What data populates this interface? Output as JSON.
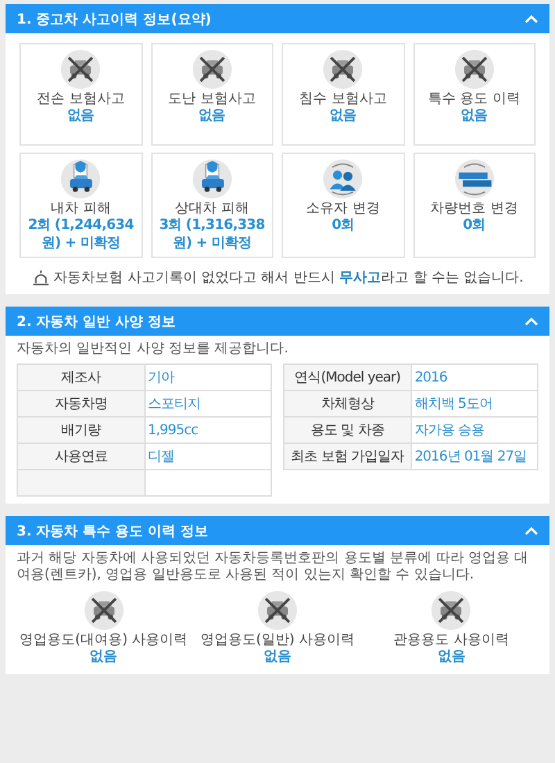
{
  "sections": [
    {
      "title": "1. 중고차 사고이력 정보(요약)",
      "expanded": true,
      "cards": [
        {
          "label": "전손 보험사고",
          "value": "없음"
        },
        {
          "label": "도난 보험사고",
          "value": "없음"
        },
        {
          "label": "침수 보험사고",
          "value": "없음"
        },
        {
          "label": "특수 용도 이력",
          "value": "없음"
        },
        {
          "label": "내차 피해",
          "value": "2회 (1,244,634 원) + 미확정"
        },
        {
          "label": "상대차 피해",
          "value": "3회 (1,316,338 원) + 미확정"
        },
        {
          "label": "소유자 변경",
          "value": "0회"
        },
        {
          "label": "차량번호 변경",
          "value": "0회"
        }
      ],
      "notice": "자동차보험 사고기록이 없었다고 해서 반드시 **무사고**라고 할 수는 없습니다."
    },
    {
      "title": "2. 자동차 일반 사양 정보",
      "expanded": true,
      "note": "자동차의 일반적인 사양 정보를 제공합니다.",
      "left_table": [
        {
          "label": "제조사",
          "value": "기아"
        },
        {
          "label": "자동차명",
          "value": "스포티지"
        },
        {
          "label": "배기량",
          "value": "1,995cc"
        },
        {
          "label": "사용연료",
          "value": "디젤"
        }
      ],
      "right_table": [
        {
          "label": "연식(Model year)",
          "value": "2016"
        },
        {
          "label": "차체형상",
          "value": "해치백 5도어"
        },
        {
          "label": "용도 및 차종",
          "value": "자가용 승용"
        },
        {
          "label": "최초 보험 가입일자",
          "value": "2016년 01월 27일"
        }
      ]
    },
    {
      "title": "3. 자동차 특수 용도 이력 정보",
      "expanded": true,
      "note": "과거 해당 자동차에 사용되었던 자동차등록번호판의 용도별 분류에 따라 영업용 대여용(렌트카), 영업용 일반용도로 사용된 적이 있는지 확인할 수 있습니다.",
      "items": [
        {
          "label": "영업용도(대여용) 사용이력",
          "value": "없음"
        },
        {
          "label": "영업용도(일반) 사용이력",
          "value": "없음"
        },
        {
          "label": "관용용도 사용이력",
          "value": "없음"
        }
      ]
    }
  ]
}
